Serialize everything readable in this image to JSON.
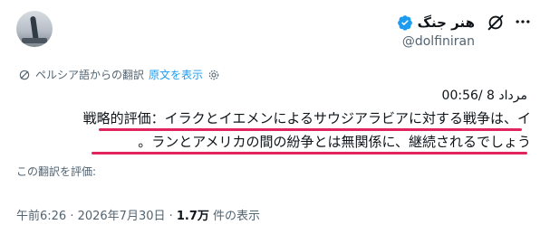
{
  "author": {
    "name": "هنر جنگ",
    "handle": "@dolfiniran"
  },
  "translation_bar": {
    "translated_from": "ペルシア語からの翻訳",
    "show_original": "原文を表示"
  },
  "post": {
    "time_fa": "00:56/ 8 مرداد",
    "line1": "戦略的評価：イラクとイエメンによるサウジアラビアに対する戦争は、イ",
    "line2": "。ランとアメリカの間の紛争とは無関係に、継続されるでしょう"
  },
  "rate_translation": "この翻訳を評価:",
  "meta": {
    "datetime": "午前6:26 · 2026年7月30日 · ",
    "views_count": "1.7万",
    "views_label": " 件の表示"
  },
  "colors": {
    "verified": "#1d9bf0",
    "underline": "#e0245e"
  }
}
